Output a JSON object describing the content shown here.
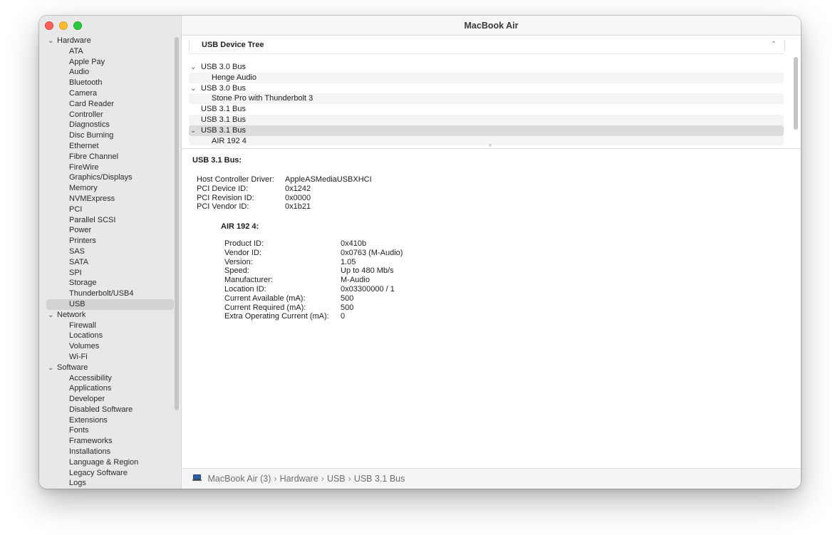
{
  "window": {
    "title": "MacBook Air"
  },
  "sidebar": {
    "rows": [
      {
        "type": "group",
        "label": "Hardware"
      },
      {
        "type": "item",
        "label": "ATA"
      },
      {
        "type": "item",
        "label": "Apple Pay"
      },
      {
        "type": "item",
        "label": "Audio"
      },
      {
        "type": "item",
        "label": "Bluetooth"
      },
      {
        "type": "item",
        "label": "Camera"
      },
      {
        "type": "item",
        "label": "Card Reader"
      },
      {
        "type": "item",
        "label": "Controller"
      },
      {
        "type": "item",
        "label": "Diagnostics"
      },
      {
        "type": "item",
        "label": "Disc Burning"
      },
      {
        "type": "item",
        "label": "Ethernet"
      },
      {
        "type": "item",
        "label": "Fibre Channel"
      },
      {
        "type": "item",
        "label": "FireWire"
      },
      {
        "type": "item",
        "label": "Graphics/Displays"
      },
      {
        "type": "item",
        "label": "Memory"
      },
      {
        "type": "item",
        "label": "NVMExpress"
      },
      {
        "type": "item",
        "label": "PCI"
      },
      {
        "type": "item",
        "label": "Parallel SCSI"
      },
      {
        "type": "item",
        "label": "Power"
      },
      {
        "type": "item",
        "label": "Printers"
      },
      {
        "type": "item",
        "label": "SAS"
      },
      {
        "type": "item",
        "label": "SATA"
      },
      {
        "type": "item",
        "label": "SPI"
      },
      {
        "type": "item",
        "label": "Storage"
      },
      {
        "type": "item",
        "label": "Thunderbolt/USB4"
      },
      {
        "type": "item",
        "label": "USB",
        "selected": true
      },
      {
        "type": "group",
        "label": "Network"
      },
      {
        "type": "item",
        "label": "Firewall"
      },
      {
        "type": "item",
        "label": "Locations"
      },
      {
        "type": "item",
        "label": "Volumes"
      },
      {
        "type": "item",
        "label": "Wi-Fi"
      },
      {
        "type": "group",
        "label": "Software"
      },
      {
        "type": "item",
        "label": "Accessibility"
      },
      {
        "type": "item",
        "label": "Applications"
      },
      {
        "type": "item",
        "label": "Developer"
      },
      {
        "type": "item",
        "label": "Disabled Software"
      },
      {
        "type": "item",
        "label": "Extensions"
      },
      {
        "type": "item",
        "label": "Fonts"
      },
      {
        "type": "item",
        "label": "Frameworks"
      },
      {
        "type": "item",
        "label": "Installations"
      },
      {
        "type": "item",
        "label": "Language & Region"
      },
      {
        "type": "item",
        "label": "Legacy Software"
      },
      {
        "type": "item",
        "label": "Logs"
      }
    ]
  },
  "tree": {
    "header": "USB Device Tree",
    "rows": [
      {
        "label": "USB 3.0 Bus",
        "kind": "parent"
      },
      {
        "label": "Henge Audio",
        "kind": "child"
      },
      {
        "label": "USB 3.0 Bus",
        "kind": "parent"
      },
      {
        "label": "Stone Pro with Thunderbolt 3",
        "kind": "child"
      },
      {
        "label": "USB 3.1 Bus",
        "kind": "plain"
      },
      {
        "label": "USB 3.1 Bus",
        "kind": "plain"
      },
      {
        "label": "USB 3.1 Bus",
        "kind": "parent",
        "selected": true
      },
      {
        "label": "AIR 192 4",
        "kind": "child"
      }
    ]
  },
  "detail": {
    "title": "USB 3.1 Bus:",
    "bus_fields": [
      {
        "key": "Host Controller Driver:",
        "value": "AppleASMediaUSBXHCI"
      },
      {
        "key": "PCI Device ID:",
        "value": "0x1242"
      },
      {
        "key": "PCI Revision ID:",
        "value": "0x0000"
      },
      {
        "key": "PCI Vendor ID:",
        "value": "0x1b21"
      }
    ],
    "device_title": "AIR 192 4:",
    "device_fields": [
      {
        "key": "Product ID:",
        "value": "0x410b"
      },
      {
        "key": "Vendor ID:",
        "value": "0x0763  (M-Audio)"
      },
      {
        "key": "Version:",
        "value": "1.05"
      },
      {
        "key": "Speed:",
        "value": "Up to 480 Mb/s"
      },
      {
        "key": "Manufacturer:",
        "value": "M-Audio"
      },
      {
        "key": "Location ID:",
        "value": "0x03300000 / 1"
      },
      {
        "key": "Current Available (mA):",
        "value": "500"
      },
      {
        "key": "Current Required (mA):",
        "value": "500"
      },
      {
        "key": "Extra Operating Current (mA):",
        "value": "0"
      }
    ]
  },
  "pathbar": {
    "crumbs": [
      "MacBook Air (3)",
      "Hardware",
      "USB",
      "USB 3.1 Bus"
    ],
    "separator": "›",
    "icon": "laptop-icon"
  }
}
